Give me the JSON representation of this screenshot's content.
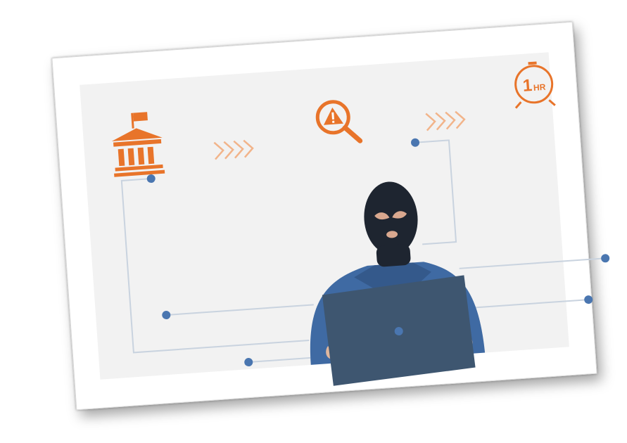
{
  "illustration": {
    "steps": [
      {
        "icon": "bank-icon"
      },
      {
        "icon": "alert-search-icon"
      },
      {
        "icon": "one-hour-clock-icon",
        "number": "1",
        "unit": "HR"
      }
    ],
    "arrows": [
      "chevrons-right-icon",
      "chevrons-right-icon"
    ],
    "colors": {
      "accent": "#e8742a",
      "accent_light": "#f2b48a",
      "panel": "#f2f2f2",
      "circuit_line": "#c9d3df",
      "circuit_dot": "#4a76b0",
      "hoodie": "#3f6aa3",
      "mask": "#1e2530",
      "laptop": "#3e5670"
    }
  }
}
